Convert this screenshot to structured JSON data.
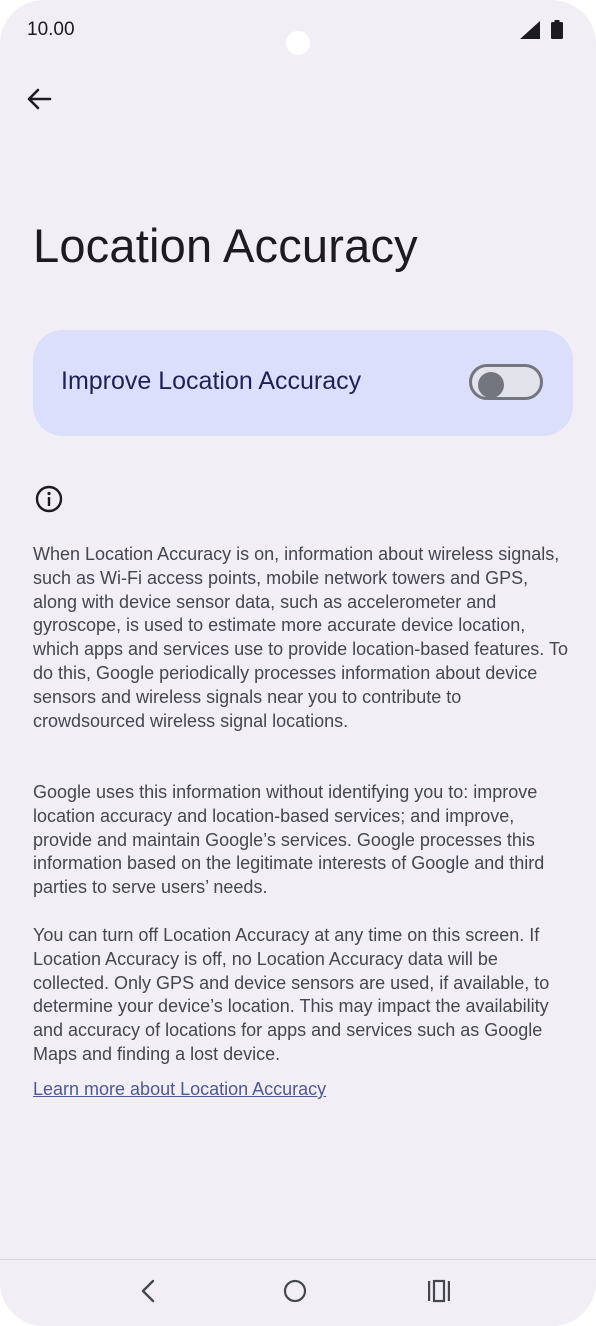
{
  "status_bar": {
    "time": "10.00",
    "icons": [
      "signal-icon",
      "battery-icon"
    ]
  },
  "header": {
    "back_icon": "arrow-left-icon",
    "title": "Location Accuracy"
  },
  "toggle": {
    "label": "Improve Location Accuracy",
    "state": "off"
  },
  "info": {
    "icon": "info-icon",
    "paragraphs": [
      "When Location Accuracy is on, information about wireless signals, such as Wi-Fi access points, mobile network towers and GPS, along with device sensor data, such as accelerometer and gyroscope, is used to estimate more accurate device location, which apps and services use to provide location-based features. To do this, Google periodically processes information about device sensors and wireless signals near you to contribute to crowdsourced wireless signal locations.",
      "Google uses this information without identifying you to: improve location accuracy and location-based services; and improve, provide and maintain Google’s services. Google processes this information based on the legitimate interests of Google and third parties to serve users’ needs.",
      "You can turn off Location Accuracy at any time on this screen. If Location Accuracy is off, no Location Accuracy data will be collected. Only GPS and device sensors are used, if available, to determine your device’s location. This may impact the availability and accuracy of locations for apps and services such as Google Maps and finding a lost device."
    ],
    "link": "Learn more about Location Accuracy"
  },
  "nav_bar": {
    "icons": [
      "nav-back-icon",
      "nav-home-icon",
      "nav-recents-icon"
    ]
  },
  "colors": {
    "background": "#f1eef6",
    "card": "#dcdffc",
    "link": "#4f5894"
  }
}
